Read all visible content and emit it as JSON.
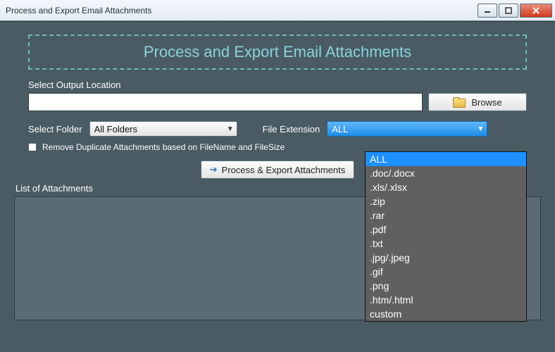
{
  "window": {
    "title": "Process and Export Email Attachments"
  },
  "header": {
    "banner": "Process and Export Email Attachments"
  },
  "output": {
    "label": "Select Output Location",
    "value": "",
    "browse_label": "Browse"
  },
  "folder": {
    "label": "Select Folder",
    "selected": "All Folders"
  },
  "extension": {
    "label": "File Extension",
    "selected": "ALL",
    "options": [
      "ALL",
      ".doc/.docx",
      ".xls/.xlsx",
      ".zip",
      ".rar",
      ".pdf",
      ".txt",
      ".jpg/.jpeg",
      ".gif",
      ".png",
      ".htm/.html",
      "custom"
    ]
  },
  "dedupe": {
    "label": "Remove Duplicate Attachments based  on FileName and FileSize",
    "checked": false
  },
  "process": {
    "label": "Process & Export Attachments"
  },
  "list": {
    "label": "List of Attachments"
  }
}
